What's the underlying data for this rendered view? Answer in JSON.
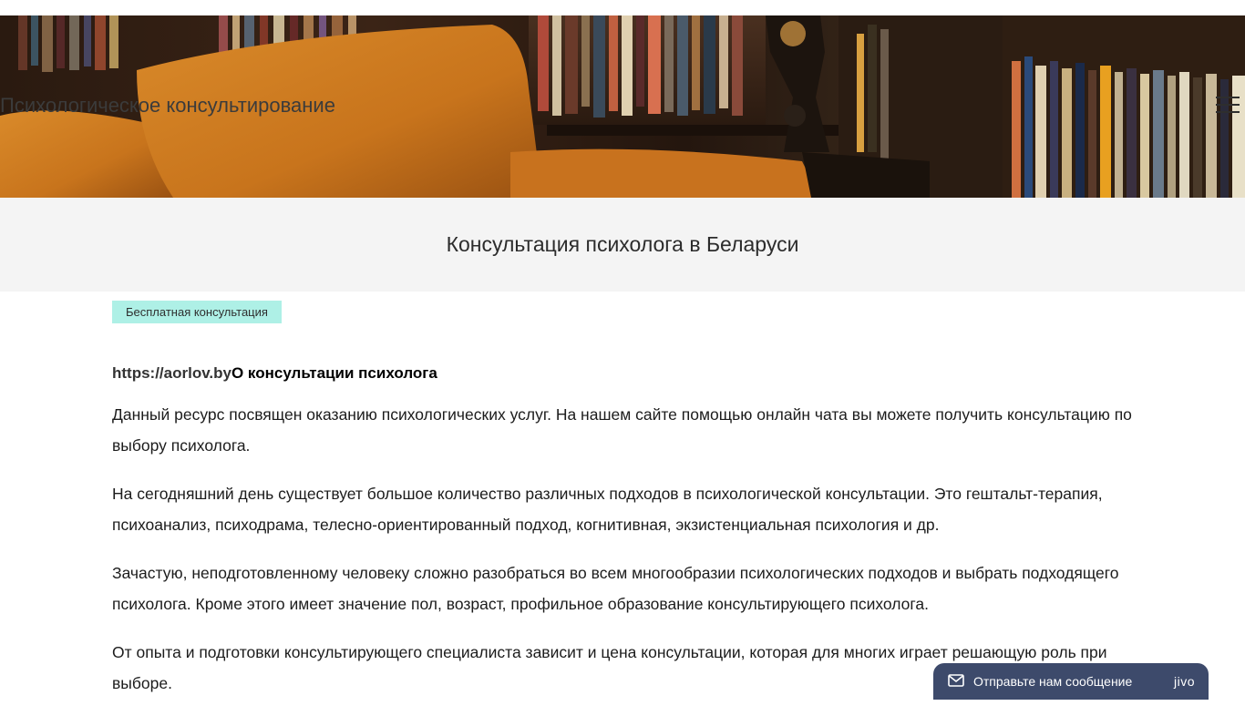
{
  "header": {
    "site_title": "Психологическое консультирование",
    "menu_icon": "hamburger-menu-icon"
  },
  "page": {
    "title": "Консультация психолога в Беларуси",
    "tag": "Бесплатная консультация"
  },
  "article": {
    "lead_url": "https://aorlov.by",
    "lead_bold": "О консультации психолога",
    "paragraphs": [
      "Данный ресурс посвящен оказанию психологических услуг. На нашем сайте  помощью онлайн чата вы можете получить консультацию по выбору психолога.",
      "На сегодняшний день существует большое количество различных подходов в психологической консультации. Это гештальт-терапия,  психоанализ,  психодрама, телесно-ориентированный подход, когнитивная, экзистенциальная психология и др.",
      "Зачастую, неподготовленному человеку сложно разобраться во всем многообразии психологических подходов и  выбрать подходящего психолога. Кроме этого имеет значение пол, возраст, профильное образование консультирующего психолога.",
      "От опыта и подготовки консультирующего специалиста зависит и цена консультации, которая для многих играет решающую роль при выборе."
    ]
  },
  "chat_widget": {
    "label": "Отправьте нам сообщение",
    "brand": "jivo",
    "icon": "envelope-icon",
    "background": "#3d4a6b"
  },
  "colors": {
    "tag_background": "#aef0e6",
    "title_band": "#f4f4f4"
  }
}
